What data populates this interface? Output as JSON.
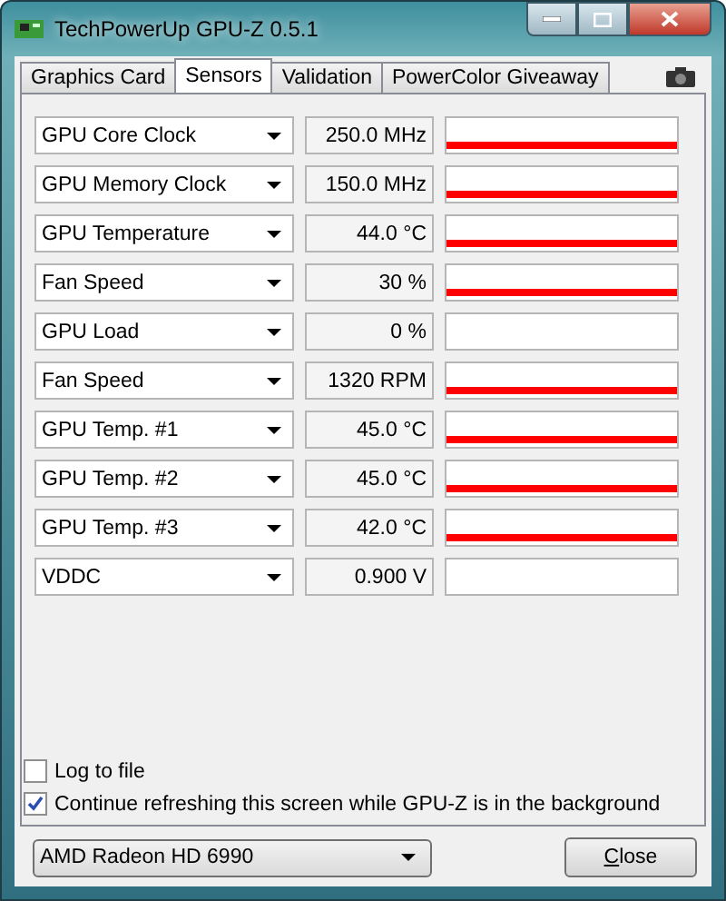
{
  "window": {
    "title": "TechPowerUp GPU-Z 0.5.1"
  },
  "tabs": [
    {
      "label": "Graphics Card",
      "selected": false
    },
    {
      "label": "Sensors",
      "selected": true
    },
    {
      "label": "Validation",
      "selected": false
    },
    {
      "label": "PowerColor Giveaway",
      "selected": false
    }
  ],
  "sensors": [
    {
      "name": "GPU Core Clock",
      "value": "250.0 MHz",
      "kind": "trace"
    },
    {
      "name": "GPU Memory Clock",
      "value": "150.0 MHz",
      "kind": "trace"
    },
    {
      "name": "GPU Temperature",
      "value": "44.0 °C",
      "kind": "trace"
    },
    {
      "name": "Fan Speed",
      "value": "30 %",
      "kind": "trace"
    },
    {
      "name": "GPU Load",
      "value": "0 %",
      "kind": "idle"
    },
    {
      "name": "Fan Speed",
      "value": "1320 RPM",
      "kind": "trace"
    },
    {
      "name": "GPU Temp. #1",
      "value": "45.0 °C",
      "kind": "trace"
    },
    {
      "name": "GPU Temp. #2",
      "value": "45.0 °C",
      "kind": "trace"
    },
    {
      "name": "GPU Temp. #3",
      "value": "42.0 °C",
      "kind": "trace"
    },
    {
      "name": "VDDC",
      "value": "0.900 V",
      "kind": "idle"
    }
  ],
  "options": [
    {
      "label": "Log to file",
      "checked": false
    },
    {
      "label": "Continue refreshing this screen while GPU-Z is in the background",
      "checked": true
    }
  ],
  "device_select": {
    "value": "AMD Radeon HD 6990"
  },
  "buttons": [
    {
      "label": "Close"
    }
  ]
}
